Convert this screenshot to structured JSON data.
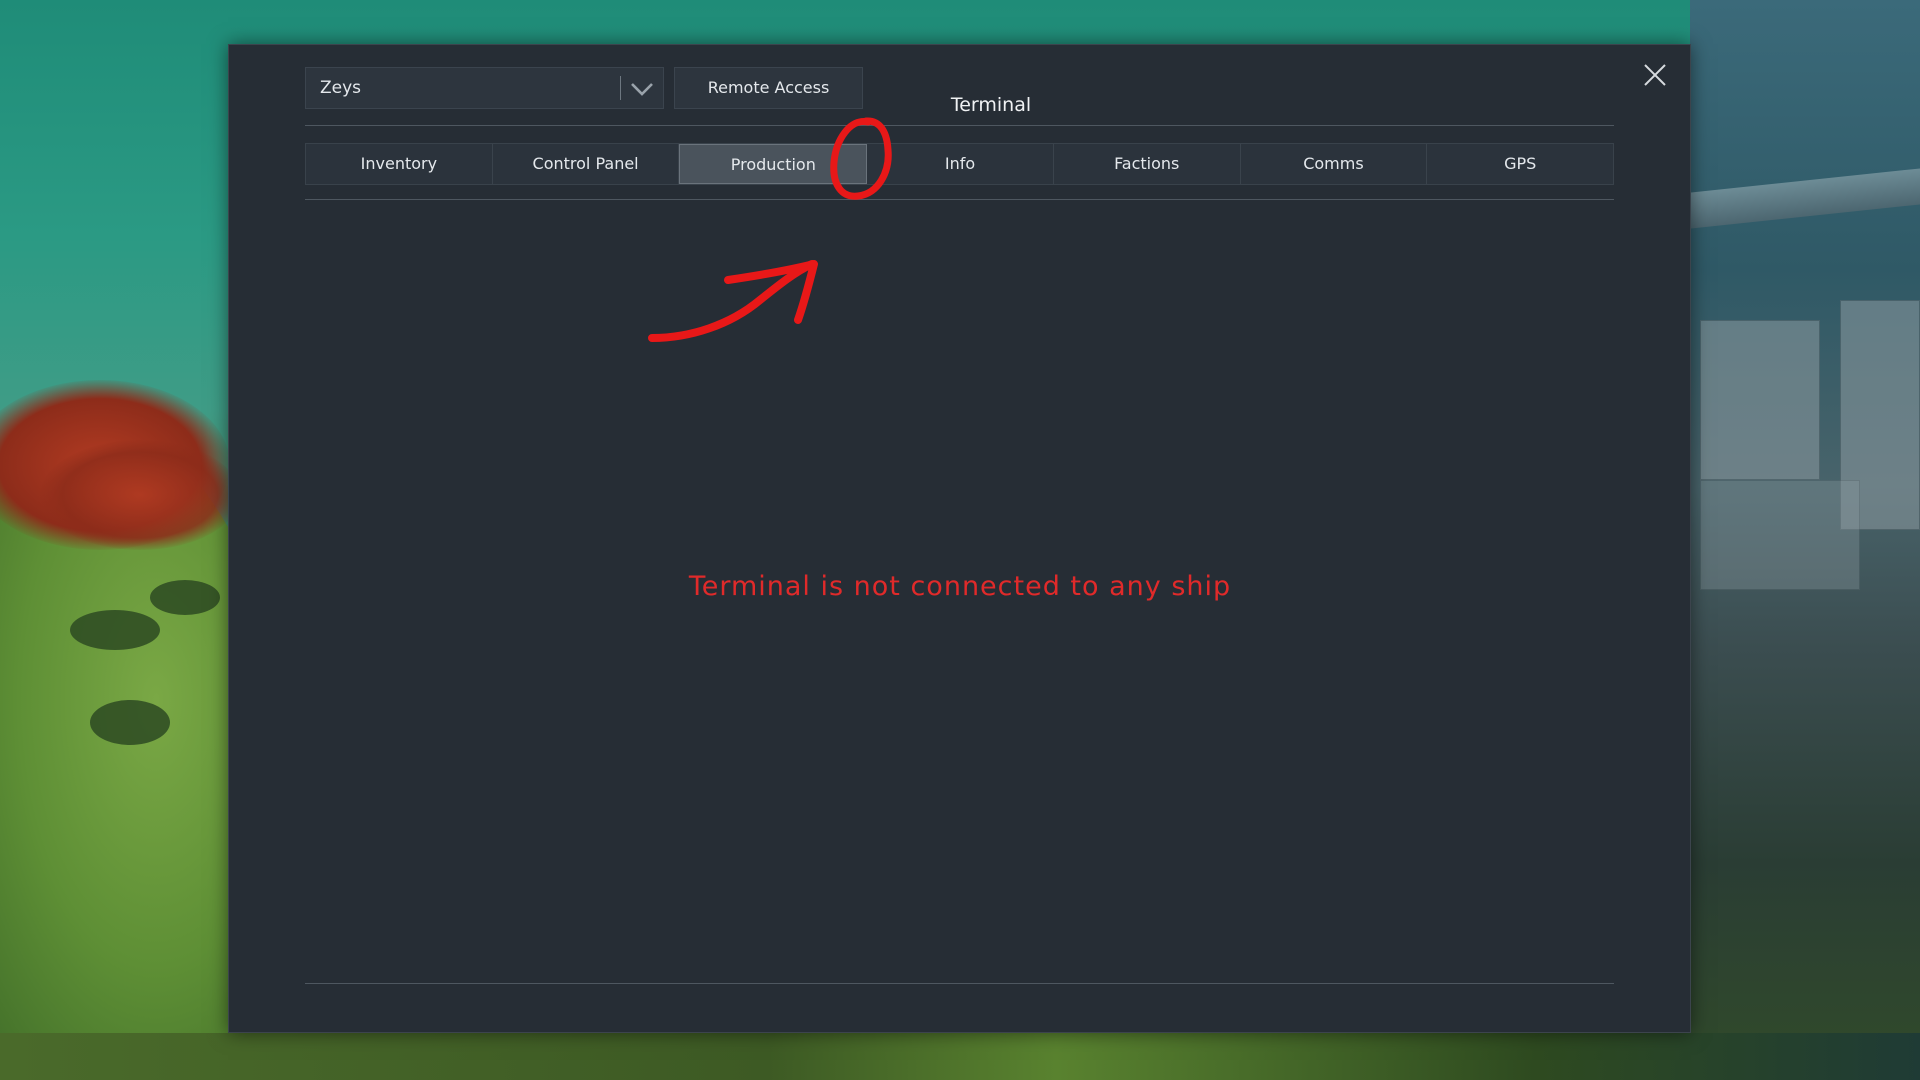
{
  "window": {
    "title": "Terminal",
    "grid_selector": {
      "value": "Zeys"
    },
    "remote_access_label": "Remote Access",
    "tabs": [
      {
        "label": "Inventory",
        "active": false
      },
      {
        "label": "Control Panel",
        "active": false
      },
      {
        "label": "Production",
        "active": true
      },
      {
        "label": "Info",
        "active": false
      },
      {
        "label": "Factions",
        "active": false
      },
      {
        "label": "Comms",
        "active": false
      },
      {
        "label": "GPS",
        "active": false
      }
    ],
    "message": "Terminal is not connected to any ship"
  },
  "icons": {
    "close": "close-icon",
    "dropdown": "chevron-down-icon"
  },
  "colors": {
    "window_bg": "#262d35",
    "tab_active_bg": "#4a535c",
    "message_text": "#e02a2a",
    "annotation": "#e81818"
  }
}
